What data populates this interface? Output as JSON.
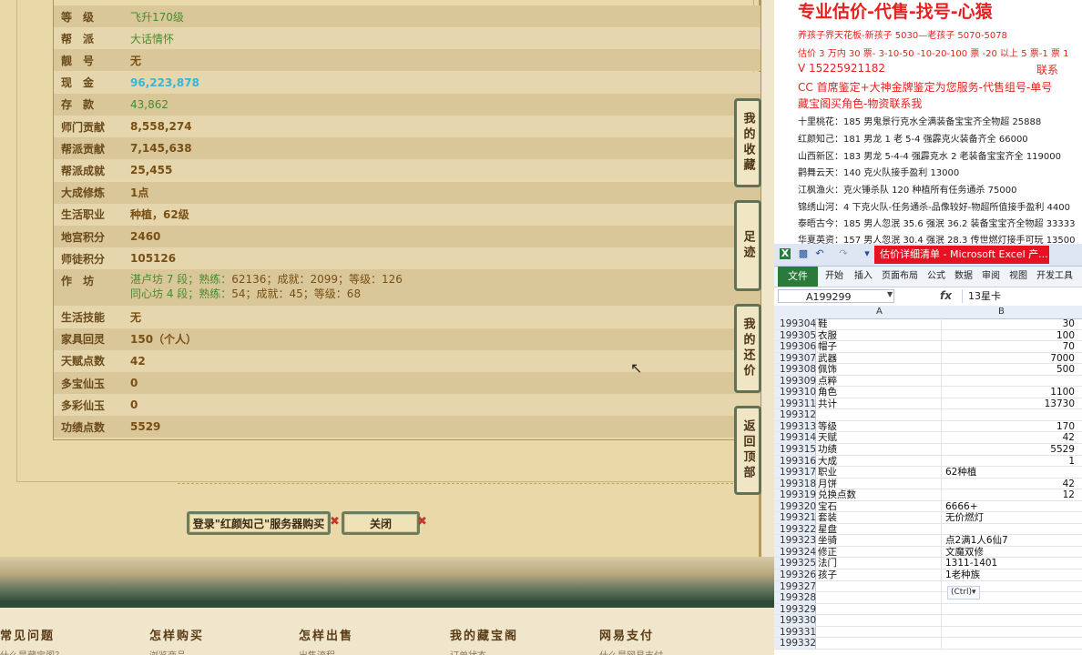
{
  "profile": {
    "rows": [
      {
        "label": "等　级",
        "value": "飞升170级",
        "style": "green"
      },
      {
        "label": "帮　派",
        "value": "大话情怀",
        "style": "green"
      },
      {
        "label": "靓　号",
        "value": "无",
        "style": "plain"
      },
      {
        "label": "现　金",
        "value": "96,223,878",
        "style": "cyan"
      },
      {
        "label": "存　款",
        "value": "43,862",
        "style": "green"
      },
      {
        "label": "师门贡献",
        "value": "8,558,274",
        "style": "plain"
      },
      {
        "label": "帮派贡献",
        "value": "7,145,638",
        "style": "plain"
      },
      {
        "label": "帮派成就",
        "value": "25,455",
        "style": "plain"
      },
      {
        "label": "大成修炼",
        "value": "1点",
        "style": "plain"
      },
      {
        "label": "生活职业",
        "value": "种植，62级",
        "style": "plain"
      },
      {
        "label": "地宫积分",
        "value": "2460",
        "style": "plain"
      },
      {
        "label": "师徒积分",
        "value": "105126",
        "style": "plain"
      }
    ],
    "workshop": {
      "label": "作　坊",
      "line1_name": "湛卢坊 7 段；熟练：",
      "line1_vals": "62136；成就：2099；等级：126",
      "line2_name": "同心坊 4 段；熟练：",
      "line2_vals": "54；成就：45；等级：68"
    },
    "rows2": [
      {
        "label": "生活技能",
        "value": "无"
      },
      {
        "label": "家具回灵",
        "value": "150（个人）"
      },
      {
        "label": "天赋点数",
        "value": "42"
      },
      {
        "label": "多宝仙玉",
        "value": "0"
      },
      {
        "label": "多彩仙玉",
        "value": "0"
      },
      {
        "label": "功绩点数",
        "value": "5529"
      }
    ]
  },
  "buttons": {
    "buy": "登录\"红颜知己\"服务器购买",
    "close": "关闭",
    "x": "✖"
  },
  "side_tabs": [
    "我的收藏",
    "足迹",
    "我的还价",
    "返回顶部"
  ],
  "footer": [
    "常见问题",
    "怎样购买",
    "怎样出售",
    "我的藏宝阁",
    "网易支付"
  ],
  "footer_sub": [
    "什么是藏宝阁？",
    "浏览商品",
    "出售流程",
    "订单状态",
    "什么是网易支付"
  ],
  "notes": {
    "title": "专业估价-代售-找号-心猿",
    "lines": [
      "养孩子界天花板-新孩子 5030—老孩子 5070-5078",
      "估价 3 万内 30 票- 3-10-50 -10-20-100 票 -20 以上 5 票-1 票 1",
      "V 15225921182",
      "CC 首席鉴定+大神金牌鉴定为您服务-代售组号-单号",
      "藏宝阁买角色-物资联系我",
      "十里桃花：185 男鬼景行克水全满装备宝宝齐全物超 25888",
      "红颜知己：181 男龙 1 老 5-4 强霹克火装备齐全 66000",
      "山西新区：183 男龙 5-4-4 强霹克水 2 老装备宝宝齐全 119000",
      "鹳舞云天：140 克火队接手盈利 13000",
      "江枫渔火：克火锤杀队 120 种植所有任务通杀 75000",
      "锦绣山河：4 下克火队-任务通杀-品像较好-物超所值接手盈利 4400",
      "泰晤古今：185 男人忽泯 35.6 强泯 36.2 装备宝宝齐全物超 33333",
      "华夏英资：157 男人忽泯 30.4 强泯 28.3 传世燃灯接手可玩 13500"
    ],
    "phone_suffix": "联系"
  },
  "excel": {
    "title": "估价详细清单 - Microsoft Excel 产...",
    "tabs": [
      "文件",
      "开始",
      "插入",
      "页面布局",
      "公式",
      "数据",
      "审阅",
      "视图",
      "开发工具"
    ],
    "name_box": "A199299",
    "fx": "fx",
    "formula": "13星卡",
    "col_a": "A",
    "col_b": "B",
    "paste_tag": "(Ctrl)▾",
    "rows": [
      {
        "n": "199304",
        "a": "鞋",
        "b": "30",
        "num": true
      },
      {
        "n": "199305",
        "a": "衣服",
        "b": "100",
        "num": true
      },
      {
        "n": "199306",
        "a": "帽子",
        "b": "70",
        "num": true
      },
      {
        "n": "199307",
        "a": "武器",
        "b": "7000",
        "num": true
      },
      {
        "n": "199308",
        "a": "佩饰",
        "b": "500",
        "num": true
      },
      {
        "n": "199309",
        "a": "点粹",
        "b": "",
        "num": true
      },
      {
        "n": "199310",
        "a": "角色",
        "b": "1100",
        "num": true
      },
      {
        "n": "199311",
        "a": "共计",
        "b": "13730",
        "num": true
      },
      {
        "n": "199312",
        "a": "",
        "b": "",
        "num": true
      },
      {
        "n": "199313",
        "a": "等级",
        "b": "170",
        "num": true
      },
      {
        "n": "199314",
        "a": "天赋",
        "b": "42",
        "num": true
      },
      {
        "n": "199315",
        "a": "功绩",
        "b": "5529",
        "num": true
      },
      {
        "n": "199316",
        "a": "大成",
        "b": "1",
        "num": true
      },
      {
        "n": "199317",
        "a": "职业",
        "b": "62种植",
        "num": false
      },
      {
        "n": "199318",
        "a": "月饼",
        "b": "42",
        "num": true
      },
      {
        "n": "199319",
        "a": "兑换点数",
        "b": "12",
        "num": true
      },
      {
        "n": "199320",
        "a": "宝石",
        "b": "6666+",
        "num": false
      },
      {
        "n": "199321",
        "a": "套装",
        "b": "无价燃灯",
        "num": false
      },
      {
        "n": "199322",
        "a": "星盘",
        "b": "",
        "num": false
      },
      {
        "n": "199323",
        "a": "坐骑",
        "b": "点2满1人6仙7",
        "num": false
      },
      {
        "n": "199324",
        "a": "修正",
        "b": "文魔双修",
        "num": false
      },
      {
        "n": "199325",
        "a": "法门",
        "b": "1311-1401",
        "num": false
      },
      {
        "n": "199326",
        "a": "孩子",
        "b": "1老种族",
        "num": false
      },
      {
        "n": "199327",
        "a": "",
        "b": "",
        "num": false
      },
      {
        "n": "199328",
        "a": "",
        "b": "",
        "num": false
      },
      {
        "n": "199329",
        "a": "",
        "b": "",
        "num": false
      },
      {
        "n": "199330",
        "a": "",
        "b": "",
        "num": false
      },
      {
        "n": "199331",
        "a": "",
        "b": "",
        "num": false
      },
      {
        "n": "199332",
        "a": "",
        "b": "",
        "num": false
      }
    ]
  }
}
